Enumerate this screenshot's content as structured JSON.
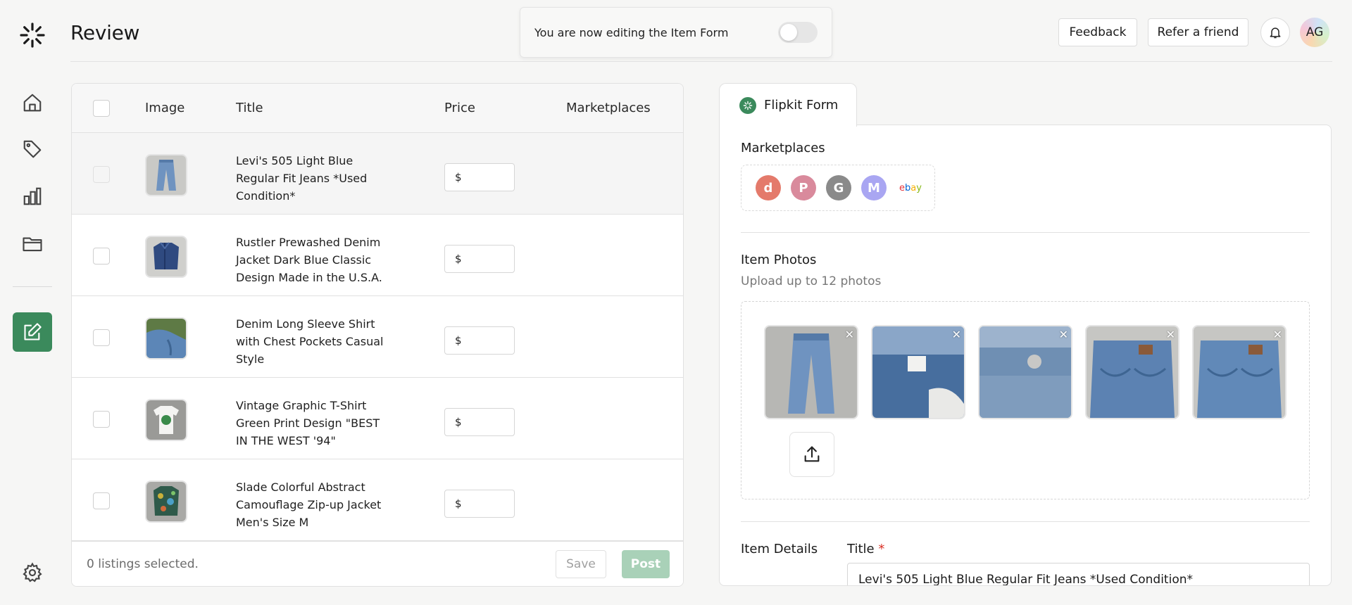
{
  "header": {
    "title": "Review",
    "edit_banner_text": "You are now editing the Item Form",
    "feedback_label": "Feedback",
    "refer_label": "Refer a friend",
    "avatar_initials": "AG"
  },
  "sidebar": {
    "items": [
      {
        "name": "home",
        "icon": "home-icon"
      },
      {
        "name": "listings",
        "icon": "tag-icon"
      },
      {
        "name": "analytics",
        "icon": "bar-chart-icon"
      },
      {
        "name": "files",
        "icon": "folder-icon"
      },
      {
        "name": "editor",
        "icon": "edit-icon",
        "active": true
      },
      {
        "name": "settings",
        "icon": "gear-icon"
      }
    ]
  },
  "table": {
    "columns": [
      "Image",
      "Title",
      "Price",
      "Marketplaces"
    ],
    "currency_symbol": "$",
    "rows": [
      {
        "title": "Levi's 505 Light Blue Regular Fit Jeans *Used Condition*",
        "price": "",
        "thumb": "jeans"
      },
      {
        "title": "Rustler Prewashed Denim Jacket Dark Blue Classic Design Made in the U.S.A.",
        "price": "",
        "thumb": "denim-jacket"
      },
      {
        "title": "Denim Long Sleeve Shirt with Chest Pockets Casual Style",
        "price": "",
        "thumb": "denim-shirt"
      },
      {
        "title": "Vintage Graphic T-Shirt Green Print Design \"BEST IN THE WEST '94\"",
        "price": "",
        "thumb": "tshirt"
      },
      {
        "title": "Slade Colorful Abstract Camouflage Zip-up Jacket Men's Size M",
        "price": "",
        "thumb": "camo-jacket"
      }
    ],
    "footer": {
      "selected_text": "0 listings selected.",
      "save_label": "Save",
      "post_label": "Post"
    }
  },
  "form": {
    "tab_label": "Flipkit Form",
    "marketplaces_label": "Marketplaces",
    "marketplaces": [
      {
        "name": "depop",
        "glyph": "d",
        "color": "#e47a6b"
      },
      {
        "name": "poshmark",
        "glyph": "P",
        "color": "#d98a9c"
      },
      {
        "name": "grailed",
        "glyph": "G",
        "color": "#8a8a8a"
      },
      {
        "name": "mercari",
        "glyph": "M",
        "color": "#a9a6f2"
      },
      {
        "name": "ebay",
        "glyph": "ebay",
        "color": "#ffffff"
      }
    ],
    "photos_label": "Item Photos",
    "photos_sub": "Upload up to 12 photos",
    "photo_count": 5,
    "details_label": "Item Details",
    "title_label": "Title",
    "required_mark": "*",
    "title_value": "Levi's 505 Light Blue Regular Fit Jeans *Used Condition*"
  }
}
